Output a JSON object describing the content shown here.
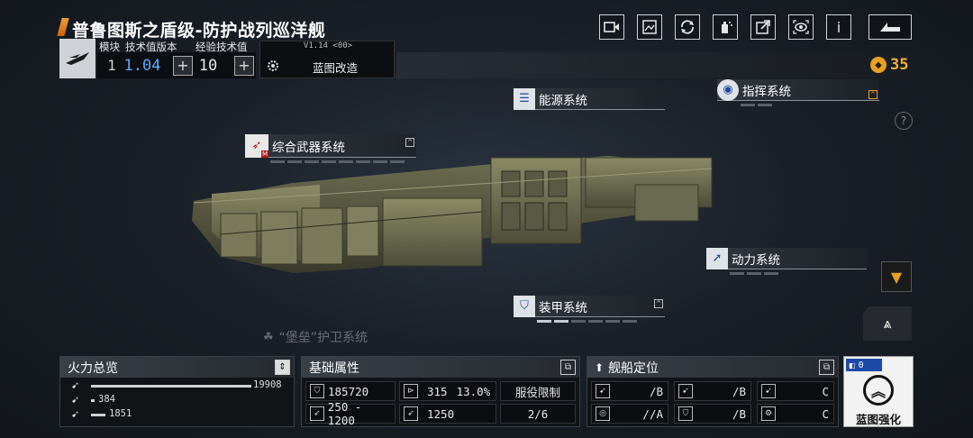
{
  "header": {
    "title": "普鲁图斯之盾级-防护战列巡洋舰",
    "top_buttons": [
      "video-icon",
      "gallery-icon",
      "refresh-icon",
      "share-icon",
      "export-icon",
      "view-icon",
      "info-icon",
      "back-icon"
    ],
    "info_label": "i"
  },
  "stats_strip": {
    "module_label": "模块",
    "tech_version_label": "技术值版本",
    "exp_tech_label": "经验技术值",
    "module_value": "1",
    "tech_version_value": "1.04",
    "exp_tech_value": "10",
    "version_text": "V1.14 <00>",
    "blueprint_mod_label": "蓝图改造",
    "currency_value": "35"
  },
  "systems": {
    "energy": "能源系统",
    "command": "指挥系统",
    "weapons": "综合武器系统",
    "weapons_badge": "M",
    "power": "动力系统",
    "armor": "装甲系统",
    "fortress": "“堡垒”护卫系统"
  },
  "firepower": {
    "title": "火力总览",
    "bars": [
      {
        "value": "19908",
        "fraction": 1.0
      },
      {
        "value": "384",
        "fraction": 0.02
      },
      {
        "value": "1851",
        "fraction": 0.09
      }
    ]
  },
  "base_attributes": {
    "title": "基础属性",
    "hp": "185720",
    "armor_val": "315",
    "armor_pct": "13.0%",
    "service_limit_label": "服役限制",
    "attack_range": "250 - 1200",
    "speed": "1250",
    "service_limit_value": "2/6"
  },
  "ship_role": {
    "title": "舰船定位",
    "grades": [
      {
        "value": "/B"
      },
      {
        "value": "/B"
      },
      {
        "value": "C"
      },
      {
        "value": "//A"
      },
      {
        "value": "/B"
      },
      {
        "value": "C"
      }
    ]
  },
  "upgrade": {
    "label": "蓝图强化",
    "count": "0"
  }
}
